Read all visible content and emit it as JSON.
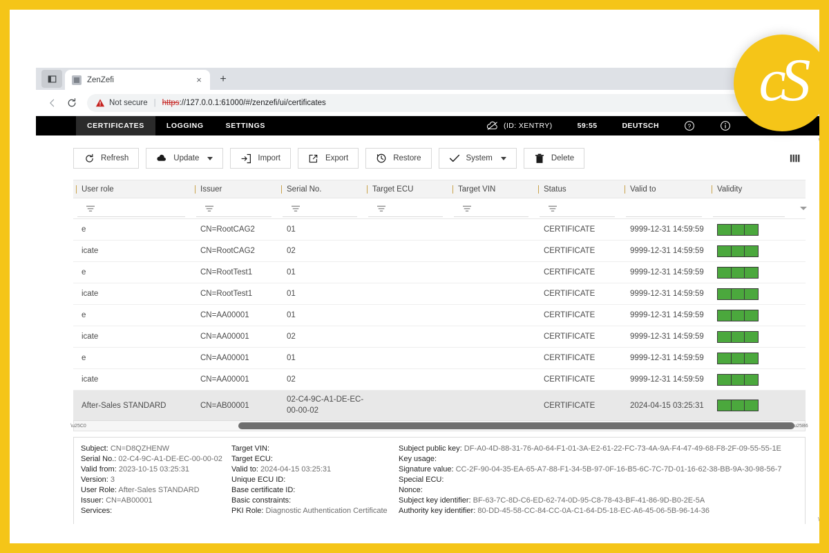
{
  "browser": {
    "tab": {
      "title": "ZenZefi",
      "close_label": "×"
    },
    "new_tab_label": "+",
    "back_label": "←",
    "reload_label": "↻",
    "security_label": "Not secure",
    "url_scheme": "https",
    "url_rest": "://127.0.0.1:61000/#/zenzefi/ui/certificates",
    "url_full": "https://127.0.0.1:61000/#/zenzefi/ui/certificates"
  },
  "appnav": {
    "tabs": [
      {
        "label": "CERTIFICATES",
        "active": true
      },
      {
        "label": "LOGGING",
        "active": false
      },
      {
        "label": "SETTINGS",
        "active": false
      }
    ],
    "connection_id": "(ID: XENTRY)",
    "timer": "59:55",
    "language": "DEUTSCH"
  },
  "toolbar": {
    "refresh": "Refresh",
    "update": "Update",
    "import": "Import",
    "export": "Export",
    "restore": "Restore",
    "system": "System",
    "delete": "Delete"
  },
  "table": {
    "columns": [
      "User role",
      "Issuer",
      "Serial No.",
      "Target ECU",
      "Target VIN",
      "Status",
      "Valid to",
      "Validity"
    ],
    "rows": [
      {
        "role": "e",
        "issuer": "CN=RootCAG2",
        "serial": "01",
        "ecu": "",
        "vin": "",
        "status": "CERTIFICATE",
        "valid_to": "9999-12-31 14:59:59",
        "validity": 3,
        "selected": false
      },
      {
        "role": "icate",
        "issuer": "CN=RootCAG2",
        "serial": "02",
        "ecu": "",
        "vin": "",
        "status": "CERTIFICATE",
        "valid_to": "9999-12-31 14:59:59",
        "validity": 3,
        "selected": false
      },
      {
        "role": "e",
        "issuer": "CN=RootTest1",
        "serial": "01",
        "ecu": "",
        "vin": "",
        "status": "CERTIFICATE",
        "valid_to": "9999-12-31 14:59:59",
        "validity": 3,
        "selected": false
      },
      {
        "role": "icate",
        "issuer": "CN=RootTest1",
        "serial": "01",
        "ecu": "",
        "vin": "",
        "status": "CERTIFICATE",
        "valid_to": "9999-12-31 14:59:59",
        "validity": 3,
        "selected": false
      },
      {
        "role": "e",
        "issuer": "CN=AA00001",
        "serial": "01",
        "ecu": "",
        "vin": "",
        "status": "CERTIFICATE",
        "valid_to": "9999-12-31 14:59:59",
        "validity": 3,
        "selected": false
      },
      {
        "role": "icate",
        "issuer": "CN=AA00001",
        "serial": "02",
        "ecu": "",
        "vin": "",
        "status": "CERTIFICATE",
        "valid_to": "9999-12-31 14:59:59",
        "validity": 3,
        "selected": false
      },
      {
        "role": "e",
        "issuer": "CN=AA00001",
        "serial": "01",
        "ecu": "",
        "vin": "",
        "status": "CERTIFICATE",
        "valid_to": "9999-12-31 14:59:59",
        "validity": 3,
        "selected": false
      },
      {
        "role": "icate",
        "issuer": "CN=AA00001",
        "serial": "02",
        "ecu": "",
        "vin": "",
        "status": "CERTIFICATE",
        "valid_to": "9999-12-31 14:59:59",
        "validity": 3,
        "selected": false
      },
      {
        "role": "After-Sales STANDARD",
        "issuer": "CN=AB00001",
        "serial": "02-C4-9C-A1-DE-EC-00-00-02",
        "ecu": "",
        "vin": "",
        "status": "CERTIFICATE",
        "valid_to": "2024-04-15 03:25:31",
        "validity": 3,
        "selected": true
      }
    ]
  },
  "detail": {
    "col1": [
      {
        "label": "Subject:",
        "value": "CN=D8QZHENW"
      },
      {
        "label": "Serial No.:",
        "value": "02-C4-9C-A1-DE-EC-00-00-02"
      },
      {
        "label": "Valid from:",
        "value": "2023-10-15 03:25:31"
      },
      {
        "label": "Version:",
        "value": "3"
      },
      {
        "label": "User Role:",
        "value": "After-Sales STANDARD"
      },
      {
        "label": "Issuer:",
        "value": "CN=AB00001"
      },
      {
        "label": "Services:",
        "value": ""
      }
    ],
    "col2": [
      {
        "label": "Target VIN:",
        "value": ""
      },
      {
        "label": "Target ECU:",
        "value": ""
      },
      {
        "label": "Valid to:",
        "value": "2024-04-15 03:25:31"
      },
      {
        "label": "Unique ECU ID:",
        "value": ""
      },
      {
        "label": "Base certificate ID:",
        "value": ""
      },
      {
        "label": "Basic constraints:",
        "value": ""
      },
      {
        "label": "PKI Role:",
        "value": "Diagnostic Authentication Certificate"
      }
    ],
    "col3": [
      {
        "label": "Subject public key:",
        "value": "DF-A0-4D-88-31-76-A0-64-F1-01-3A-E2-61-22-FC-73-4A-9A-F4-47-49-68-F8-2F-09-55-55-1E"
      },
      {
        "label": "Key usage:",
        "value": ""
      },
      {
        "label": "Signature value:",
        "value": "CC-2F-90-04-35-EA-65-A7-88-F1-34-5B-97-0F-16-B5-6C-7C-7D-01-16-62-38-BB-9A-30-98-56-7"
      },
      {
        "label": "Special ECU:",
        "value": ""
      },
      {
        "label": "Nonce:",
        "value": ""
      },
      {
        "label": "Subject key identifier:",
        "value": "BF-63-7C-8D-C6-ED-62-74-0D-95-C8-78-43-BF-41-86-9D-B0-2E-5A"
      },
      {
        "label": "Authority key identifier:",
        "value": "80-DD-45-58-CC-84-CC-0A-C1-64-D5-18-EC-A6-45-06-5B-96-14-36"
      }
    ]
  },
  "logo": {
    "text": "cS"
  },
  "colors": {
    "brand_yellow": "#f5c518",
    "nav_black": "#000000",
    "validity_green": "#4ba83d",
    "warning_red": "#c5221f"
  }
}
